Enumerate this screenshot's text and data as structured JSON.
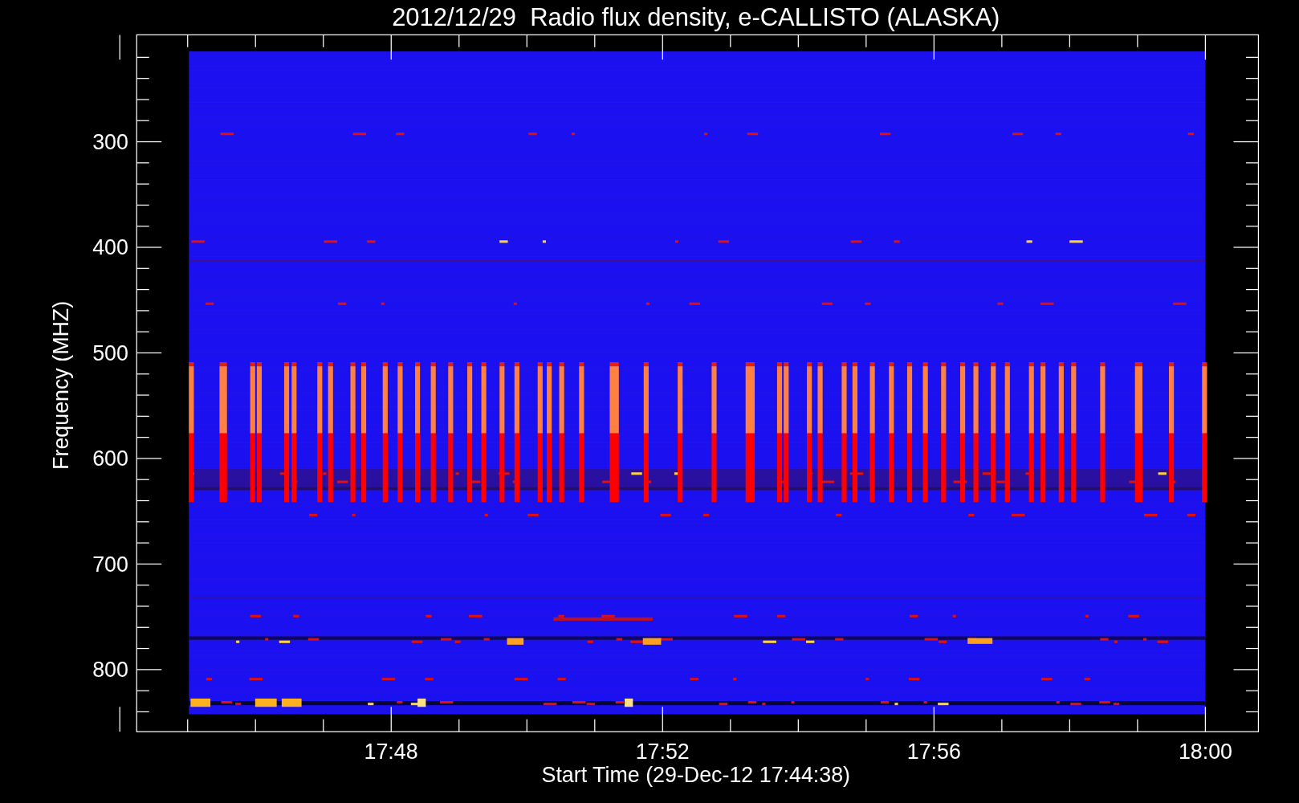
{
  "title": "2012/12/29  Radio flux density, e-CALLISTO (ALASKA)",
  "ylabel": "Frequency (MHZ)",
  "xlabel": "Start Time (29-Dec-12 17:44:38)",
  "yticks": [
    "300",
    "400",
    "500",
    "600",
    "700",
    "800"
  ],
  "xticks": [
    "17:48",
    "17:52",
    "17:56",
    "18:00"
  ]
}
